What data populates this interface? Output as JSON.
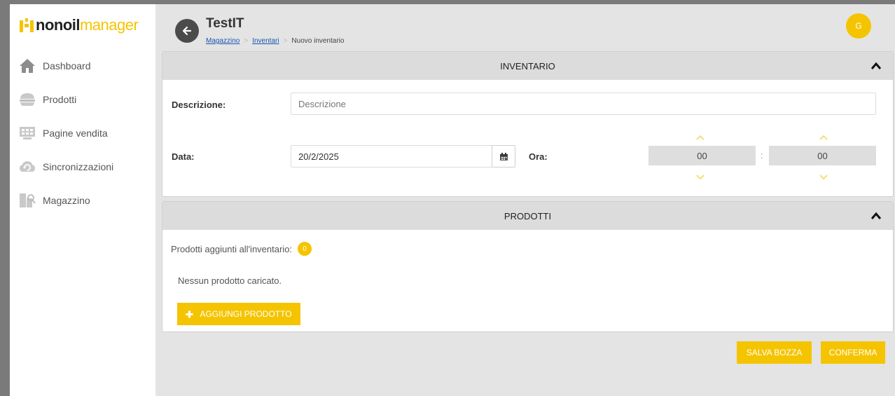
{
  "app": {
    "logo_part1": "nonoil",
    "logo_part2": "manager"
  },
  "sidebar": {
    "items": [
      {
        "label": "Dashboard",
        "icon": "home-icon"
      },
      {
        "label": "Prodotti",
        "icon": "burger-icon"
      },
      {
        "label": "Pagine vendita",
        "icon": "pos-icon"
      },
      {
        "label": "Sincronizzazioni",
        "icon": "cloud-sync-icon"
      },
      {
        "label": "Magazzino",
        "icon": "warehouse-icon"
      }
    ]
  },
  "header": {
    "title": "TestIT",
    "breadcrumb": [
      "Magazzino",
      "Inventari",
      "Nuovo inventario"
    ],
    "avatar_initial": "G"
  },
  "inventario_panel": {
    "title": "INVENTARIO",
    "descrizione_label": "Descrizione:",
    "descrizione_placeholder": "Descrizione",
    "descrizione_value": "",
    "data_label": "Data:",
    "data_value": "20/2/2025",
    "ora_label": "Ora:",
    "ora_hours": "00",
    "ora_minutes": "00",
    "ora_separator": ":"
  },
  "prodotti_panel": {
    "title": "PRODOTTI",
    "count_label": "Prodotti aggiunti all'inventario:",
    "count": "0",
    "empty_text": "Nessun prodotto caricato.",
    "add_button": "AGGIUNGI PRODOTTO"
  },
  "footer": {
    "save_draft": "SALVA BOZZA",
    "confirm": "CONFERMA"
  },
  "colors": {
    "accent": "#f5c400",
    "header_bg": "#dcdcdc",
    "page_bg": "#e4e4e4"
  }
}
